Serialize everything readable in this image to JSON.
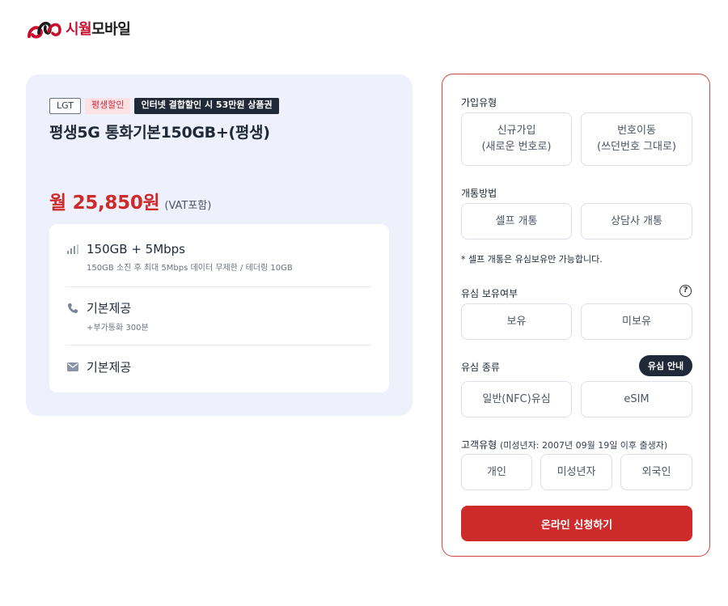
{
  "brand": {
    "logo_red": "시월",
    "logo_dark": "모바일",
    "accent_color": "#cd2b2b"
  },
  "plan": {
    "tags": [
      "LGT",
      "평생할인",
      "인터넷 결합할인 시 53만원 상품권"
    ],
    "name": "평생5G 통화기본150GB+(평생)",
    "price": "월 25,850원",
    "vat_note": "(VAT포함)",
    "features": [
      {
        "icon": "signal-icon",
        "title": "150GB + 5Mbps",
        "sub": "150GB 소진 후 최대 5Mbps 데이터 무제한 / 테더링 10GB"
      },
      {
        "icon": "phone-icon",
        "title": "기본제공",
        "sub": "+부가통화 300분"
      },
      {
        "icon": "mail-icon",
        "title": "기본제공",
        "sub": ""
      }
    ]
  },
  "form": {
    "join_type": {
      "label": "가입유형",
      "options": [
        {
          "line1": "신규가입",
          "line2": "(새로운 번호로)"
        },
        {
          "line1": "번호이동",
          "line2": "(쓰던번호 그대로)"
        }
      ]
    },
    "activation": {
      "label": "개통방법",
      "options": [
        "셀프 개통",
        "상담사 개통"
      ],
      "note": "* 셀프 개통은 유심보유만 가능합니다."
    },
    "usim_owned": {
      "label": "유심 보유여부",
      "help_icon": "question-icon",
      "options": [
        "보유",
        "미보유"
      ]
    },
    "usim_type": {
      "label": "유심 종류",
      "guide_button": "유심 안내",
      "options": [
        "일반(NFC)유심",
        "eSIM"
      ]
    },
    "customer_type": {
      "label": "고객유형",
      "sub": "(미성년자: 2007년 09월 19일 이후 출생자)",
      "options": [
        "개인",
        "미성년자",
        "외국인"
      ]
    },
    "submit": "온라인 신청하기"
  }
}
